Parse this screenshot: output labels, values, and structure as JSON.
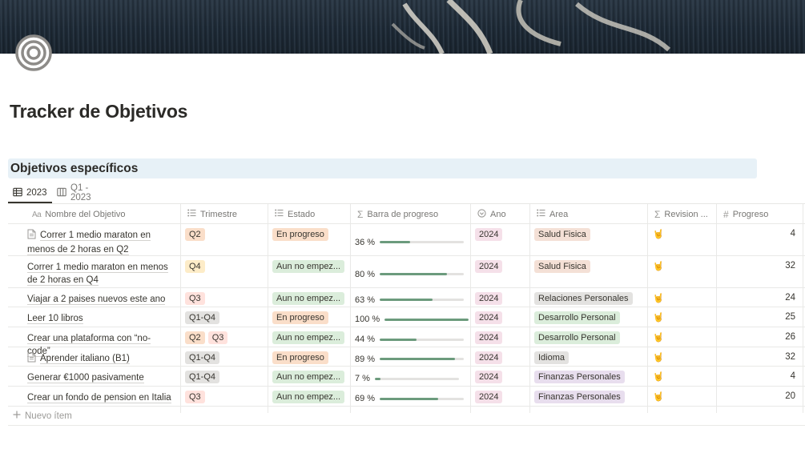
{
  "page": {
    "title": "Tracker de Objetivos"
  },
  "section": {
    "heading": "Objetivos específicos"
  },
  "views": [
    {
      "label": "2023",
      "icon": "table-icon"
    },
    {
      "label": "Q1 - 2023",
      "icon": "board-icon"
    }
  ],
  "columns": [
    {
      "label": "Nombre del Objetivo",
      "icon": "text-aa-icon"
    },
    {
      "label": "Trimestre",
      "icon": "multiselect-list-icon"
    },
    {
      "label": "Estado",
      "icon": "multiselect-list-icon"
    },
    {
      "label": "Barra de progreso",
      "icon": "sigma-formula-icon"
    },
    {
      "label": "Ano",
      "icon": "select-circle-icon"
    },
    {
      "label": "Area",
      "icon": "multiselect-list-icon"
    },
    {
      "label": "Revision ...",
      "icon": "sigma-formula-icon"
    },
    {
      "label": "Progreso",
      "icon": "hash-number-icon"
    }
  ],
  "rows": [
    {
      "name": "Correr 1 medio maraton en menos de 2 horas en Q2",
      "has_doc_icon": true,
      "trimestre": [
        "Q2"
      ],
      "estado": "En progreso",
      "progress_label": "36 %",
      "progress": 0.36,
      "ano": "2024",
      "area": "Salud Fisica",
      "revision": "🤘",
      "progreso": "4"
    },
    {
      "name": "Correr 1 medio maraton en menos de 2 horas en Q4",
      "has_doc_icon": false,
      "trimestre": [
        "Q4"
      ],
      "estado": "Aun no empez...",
      "progress_label": "80 %",
      "progress": 0.8,
      "ano": "2024",
      "area": "Salud Fisica",
      "revision": "🤘",
      "progreso": "32"
    },
    {
      "name": "Viajar a 2 paises nuevos este ano",
      "has_doc_icon": false,
      "trimestre": [
        "Q3"
      ],
      "estado": "Aun no empez...",
      "progress_label": "63 %",
      "progress": 0.63,
      "ano": "2024",
      "area": "Relaciones Personales",
      "revision": "🤘",
      "progreso": "24"
    },
    {
      "name": "Leer 10 libros",
      "has_doc_icon": false,
      "trimestre": [
        "Q1-Q4"
      ],
      "estado": "En progreso",
      "progress_label": "100 %",
      "progress": 1.0,
      "ano": "2024",
      "area": "Desarrollo Personal",
      "revision": "🤘",
      "progreso": "25"
    },
    {
      "name": "Crear una plataforma con “no-code”",
      "has_doc_icon": false,
      "trimestre": [
        "Q2",
        "Q3"
      ],
      "estado": "Aun no empez...",
      "progress_label": "44 %",
      "progress": 0.44,
      "ano": "2024",
      "area": "Desarrollo Personal",
      "revision": "🤘",
      "progreso": "26"
    },
    {
      "name": "Aprender italiano (B1)",
      "has_doc_icon": true,
      "trimestre": [
        "Q1-Q4"
      ],
      "estado": "En progreso",
      "progress_label": "89 %",
      "progress": 0.89,
      "ano": "2024",
      "area": "Idioma",
      "revision": "🤘",
      "progreso": "32"
    },
    {
      "name": "Generar €1000 pasivamente",
      "has_doc_icon": false,
      "trimestre": [
        "Q1-Q4"
      ],
      "estado": "Aun no empez...",
      "progress_label": "7 %",
      "progress": 0.07,
      "ano": "2024",
      "area": "Finanzas Personales",
      "revision": "🤘",
      "progreso": "4"
    },
    {
      "name": "Crear un fondo de pension en Italia",
      "has_doc_icon": false,
      "trimestre": [
        "Q3"
      ],
      "estado": "Aun no empez...",
      "progress_label": "69 %",
      "progress": 0.69,
      "ano": "2024",
      "area": "Finanzas Personales",
      "revision": "🤘",
      "progreso": "20"
    }
  ],
  "new_item_label": "Nuevo ítem",
  "colors": {
    "Q2": "#fadec9",
    "Q3": "#ffe2dd",
    "Q4": "#fdecc8",
    "Q1-Q4": "#e3e2e0",
    "En progreso": "#fadec9",
    "Aun no empez...": "#dbeddb",
    "2024": "#f5e0e9",
    "Salud Fisica": "#f4e0d6",
    "Relaciones Personales": "#e3e2e0",
    "Desarrollo Personal": "#dbeddb",
    "Idioma": "#e3e2e0",
    "Finanzas Personales": "#e8deee",
    "progress_bar": "#6c9b7d",
    "section_bg": "#e7f1f7"
  }
}
